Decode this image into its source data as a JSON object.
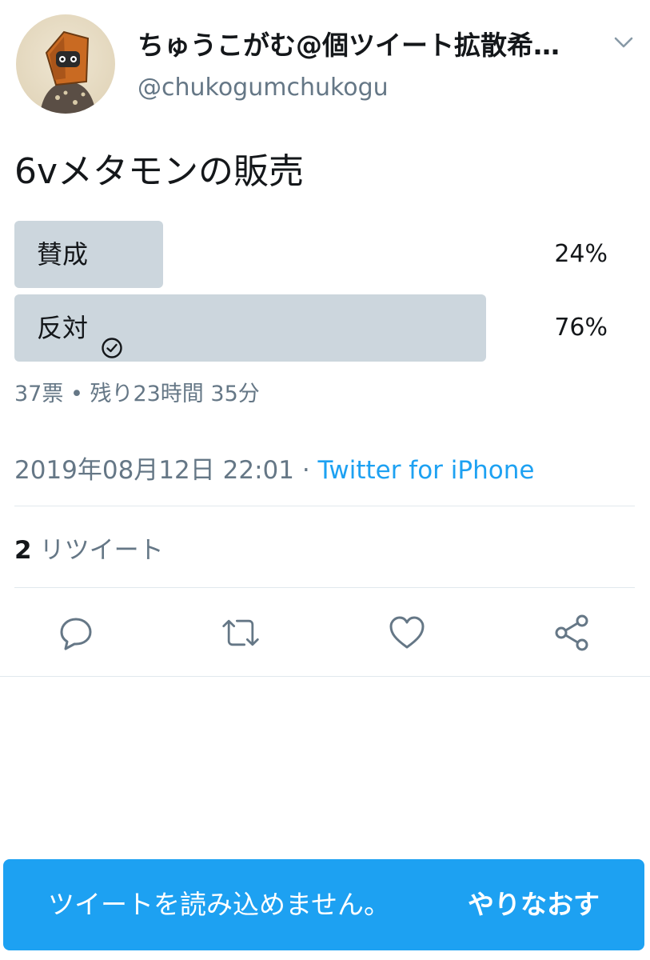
{
  "user": {
    "display_name": "ちゅうこがむ@個ツイート拡散希…",
    "handle": "@chukogumchukogu"
  },
  "tweet": {
    "text": "6vメタモンの販売"
  },
  "poll": {
    "options": [
      {
        "label": "賛成",
        "percent_text": "24%",
        "fraction": 0.24,
        "selected": false
      },
      {
        "label": "反対",
        "percent_text": "76%",
        "fraction": 0.76,
        "selected": true
      }
    ],
    "meta": "37票 • 残り23時間 35分"
  },
  "timestamp": {
    "datetime": "2019年08月12日 22:01",
    "separator": " · ",
    "source": "Twitter for iPhone"
  },
  "stats": {
    "retweet_count": "2",
    "retweet_label": "リツイート"
  },
  "actions": [
    "reply-icon",
    "retweet-icon",
    "like-icon",
    "share-icon"
  ],
  "banner": {
    "message": "ツイートを読み込めません。",
    "retry": "やりなおす"
  },
  "colors": {
    "accent": "#1da1f2",
    "poll_bar": "#ccd6dd",
    "secondary_text": "#657786"
  }
}
